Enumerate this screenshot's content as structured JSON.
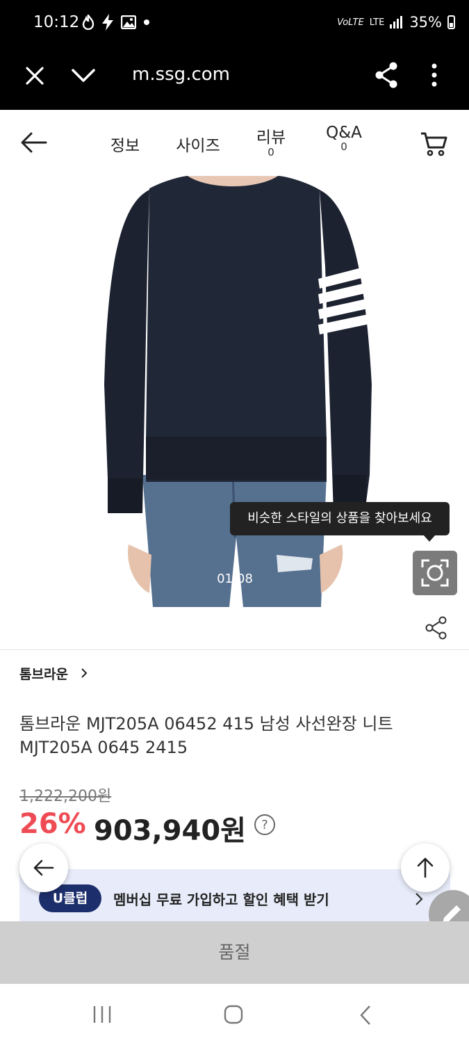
{
  "status_bar": {
    "time": "10:12",
    "network": "LTE",
    "battery": "35%"
  },
  "browser": {
    "url": "m.ssg.com"
  },
  "header": {
    "tabs": [
      {
        "label": "정보",
        "count": ""
      },
      {
        "label": "사이즈",
        "count": ""
      },
      {
        "label": "리뷰",
        "count": "0"
      },
      {
        "label": "Q&A",
        "count": "0"
      }
    ]
  },
  "gallery": {
    "tooltip": "비슷한 스타일의 상품을 찾아보세요",
    "counter": "01/08"
  },
  "product": {
    "brand": "톰브라운",
    "title": "톰브라운 MJT205A 06452 415 남성 사선완장 니트 MJT205A 0645 2415",
    "original_price": "1,222,200원",
    "discount": "26%",
    "price": "903,940원"
  },
  "membership": {
    "badge": "U클럽",
    "text": "멤버십 무료 가입하고 할인 혜택 받기"
  },
  "purchase": {
    "status": "품절"
  },
  "icons": {
    "close": "close-icon",
    "chevron": "chevron-down-icon",
    "share": "share-icon",
    "more": "more-vert-icon",
    "back": "back-arrow-icon",
    "cart": "cart-icon",
    "lens": "visual-search-icon",
    "up": "arrow-up-icon",
    "pencil": "pencil-icon"
  },
  "colors": {
    "discount": "#ef4b55",
    "uclub": "#1c2e6b",
    "banner_bg": "#e8ecfa"
  }
}
